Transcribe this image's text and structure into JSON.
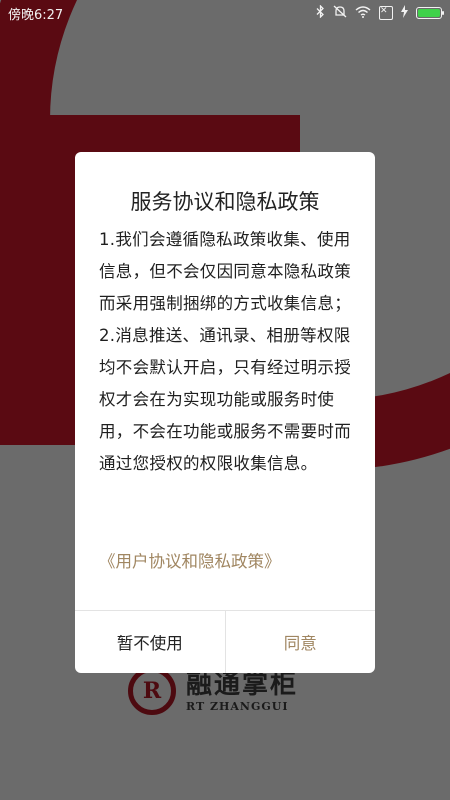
{
  "status_bar": {
    "time": "傍晚6:27",
    "icons": [
      "bluetooth-icon",
      "mute-icon",
      "wifi-icon",
      "close-box-icon",
      "charging-icon",
      "battery-icon"
    ],
    "battery_level": 1.0
  },
  "dialog": {
    "title": "服务协议和隐私政策",
    "paragraphs": [
      "1.我们会遵循隐私政策收集、使用信息，但不会仅因同意本隐私政策而采用强制捆绑的方式收集信息；",
      "2.消息推送、通讯录、相册等权限均不会默认开启，只有经过明示授权才会在为实现功能或服务时使用，不会在功能或服务不需要时而通过您授权的权限收集信息。"
    ],
    "link": "《用户协议和隐私政策》",
    "decline_label": "暂不使用",
    "agree_label": "同意"
  },
  "logo": {
    "mark": "R",
    "name_cn": "融通掌柜",
    "name_en": "RT ZHANGGUI"
  },
  "colors": {
    "brand": "#8b1520",
    "link": "#a08661",
    "overlay": "#6b6b6b"
  }
}
